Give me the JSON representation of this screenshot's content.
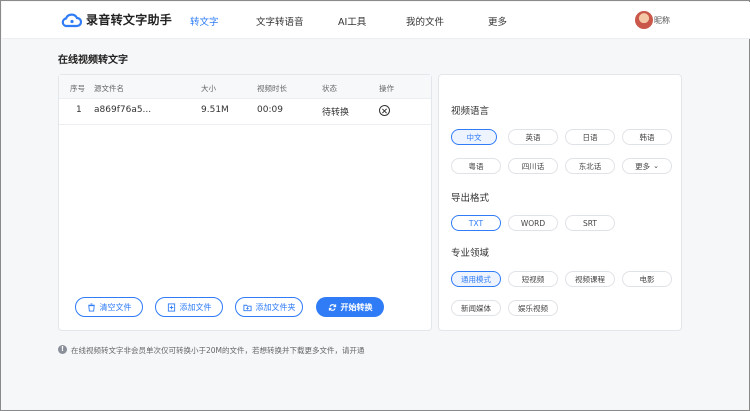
{
  "header": {
    "brand": "录音转文字助手",
    "nav": [
      "转文字",
      "文字转语音",
      "AI工具",
      "我的文件",
      "更多"
    ],
    "active_nav": "转文字",
    "nickname": "昵称"
  },
  "page_title": "在线视频转文字",
  "table": {
    "headers": [
      "序号",
      "源文件名",
      "大小",
      "视频时长",
      "状态",
      "操作"
    ],
    "rows": [
      {
        "index": "1",
        "filename": "a869f76a5...",
        "size": "9.51M",
        "duration": "00:09",
        "status": "待转换"
      }
    ]
  },
  "actions": {
    "clear": "清空文件",
    "add_file": "添加文件",
    "add_folder": "添加文件夹",
    "start": "开始转换"
  },
  "settings": {
    "language_label": "视频语言",
    "languages": [
      "中文",
      "英语",
      "日语",
      "韩语",
      "粤语",
      "四川话",
      "东北话",
      "更多"
    ],
    "selected_language": "中文",
    "format_label": "导出格式",
    "formats": [
      "TXT",
      "WORD",
      "SRT"
    ],
    "selected_format": "TXT",
    "domain_label": "专业领域",
    "domains": [
      "通用模式",
      "短视频",
      "视频课程",
      "电影",
      "新闻媒体",
      "娱乐视频"
    ],
    "selected_domain": "通用模式"
  },
  "notice": "在线视频转文字非会员单次仅可转换小于20M的文件，若想转换并下载更多文件，请开通",
  "colors": {
    "accent": "#2f7cf6",
    "background": "#f6f7f9",
    "border": "#e3e6eb"
  }
}
